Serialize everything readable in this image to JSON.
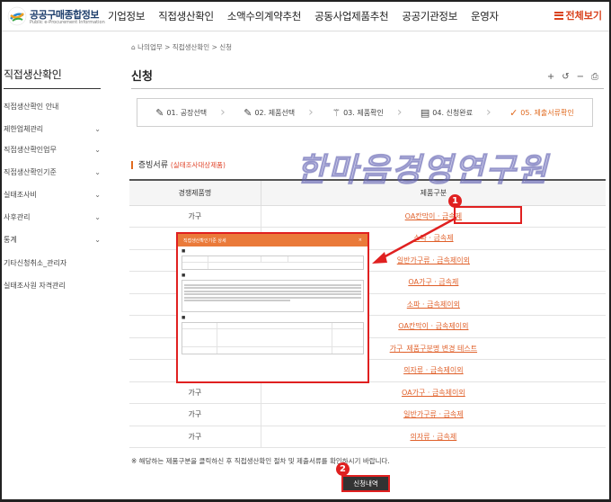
{
  "header": {
    "logo_text": "공공구매종합정보",
    "logo_sub": "Public e-Procurement Information",
    "nav": [
      "기업정보",
      "직접생산확인",
      "소액수의계약추천",
      "공동사업제품추천",
      "공공기관정보",
      "운영자"
    ],
    "all_menu": "전체보기"
  },
  "sidebar": {
    "title": "직접생산확인",
    "items": [
      {
        "label": "직접생산확인 안내",
        "chevron": false
      },
      {
        "label": "제한업체관리",
        "chevron": true
      },
      {
        "label": "직접생산확인업무",
        "chevron": true
      },
      {
        "label": "직접생산확인기준",
        "chevron": true
      },
      {
        "label": "실태조사비",
        "chevron": true
      },
      {
        "label": "사후관리",
        "chevron": true
      },
      {
        "label": "통계",
        "chevron": true
      },
      {
        "label": "기타신청취소_관리자",
        "chevron": false
      },
      {
        "label": "실태조사원 자격관리",
        "chevron": false
      }
    ]
  },
  "breadcrumb": "나의업무 > 직접생산확인 > 신청",
  "page_title": "신청",
  "tools": [
    "+",
    "↺",
    "−",
    "⎙"
  ],
  "steps": [
    {
      "label": "01. 공장선택",
      "icon": "pencil-icon",
      "active": false
    },
    {
      "label": "02. 제품선택",
      "icon": "pencil-icon",
      "active": false
    },
    {
      "label": "03. 제품확인",
      "icon": "magic-wand-icon",
      "active": false
    },
    {
      "label": "04. 신청완료",
      "icon": "document-icon",
      "active": false
    },
    {
      "label": "05. 제출서류확인",
      "icon": "check-icon",
      "active": true
    }
  ],
  "section": {
    "title": "증빙서류",
    "subtitle": "(실태조사대상제품)"
  },
  "watermark": "한마음경영연구원",
  "table": {
    "headers": [
      "경쟁제품명",
      "제품구분"
    ],
    "rows": [
      {
        "name": "가구",
        "type": "OA칸막이 · 금속제"
      },
      {
        "name": "가구",
        "type": "소파 · 금속제"
      },
      {
        "name": "가구",
        "type": "일반가구류 · 금속제이외"
      },
      {
        "name": "가구",
        "type": "OA가구 · 금속제"
      },
      {
        "name": "가구",
        "type": "소파 · 금속제이외"
      },
      {
        "name": "가구",
        "type": "OA칸막이 · 금속제이외"
      },
      {
        "name": "가구",
        "type": "가구_제품구분명 변경 테스트"
      },
      {
        "name": "가구",
        "type": "의자류 · 금속제이외"
      },
      {
        "name": "가구",
        "type": "OA가구 · 금속제이외"
      },
      {
        "name": "가구",
        "type": "일반가구류 · 금속제"
      },
      {
        "name": "가구",
        "type": "의자류 · 금속제"
      }
    ]
  },
  "note": "※ 해당하는 제품구분을 클릭하신 후 직접생산확인 절차 및 제출서류를 확인하시기 바랍니다.",
  "submit_label": "신청내역",
  "annotations": {
    "badge1": "1",
    "badge2": "2"
  },
  "doc_preview": {
    "header": "직접생산확인기준 상세"
  },
  "colors": {
    "accent": "#e06a1f",
    "annotation": "#e02020",
    "brand": "#1c3d6b"
  }
}
